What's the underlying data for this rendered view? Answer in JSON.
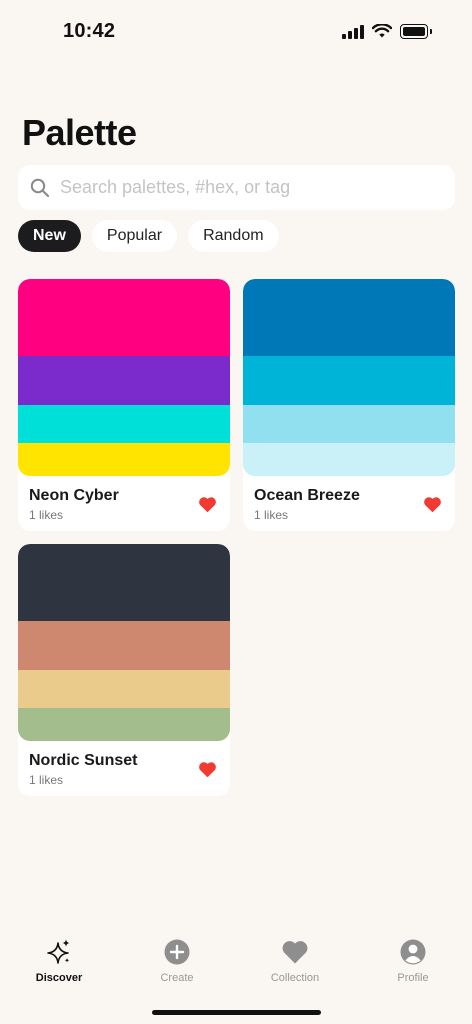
{
  "status_bar": {
    "time": "10:42"
  },
  "page": {
    "title": "Palette"
  },
  "search": {
    "placeholder": "Search palettes, #hex, or tag",
    "value": ""
  },
  "filters": [
    {
      "label": "New",
      "active": true
    },
    {
      "label": "Popular",
      "active": false
    },
    {
      "label": "Random",
      "active": false
    }
  ],
  "palettes": [
    {
      "name": "Neon Cyber",
      "likes": "1 likes",
      "liked": true,
      "colors": [
        "#ff0080",
        "#7b2bcc",
        "#00e0d9",
        "#ffe400"
      ]
    },
    {
      "name": "Ocean Breeze",
      "likes": "1 likes",
      "liked": true,
      "colors": [
        "#0077b6",
        "#00b4d8",
        "#90e0ef",
        "#caf0f8"
      ]
    },
    {
      "name": "Nordic Sunset",
      "likes": "1 likes",
      "liked": true,
      "colors": [
        "#2f3540",
        "#cf8870",
        "#ebcb8b",
        "#a3be8c"
      ]
    }
  ],
  "tabs": [
    {
      "label": "Discover",
      "icon": "sparkles-icon",
      "active": true
    },
    {
      "label": "Create",
      "icon": "plus-circle-icon",
      "active": false
    },
    {
      "label": "Collection",
      "icon": "heart-icon",
      "active": false
    },
    {
      "label": "Profile",
      "icon": "person-circle-icon",
      "active": false
    }
  ],
  "colors": {
    "background": "#faf6f2",
    "heart": "#f03a32",
    "active_chip": "#1c1c1e",
    "tab_inactive": "#999999"
  }
}
